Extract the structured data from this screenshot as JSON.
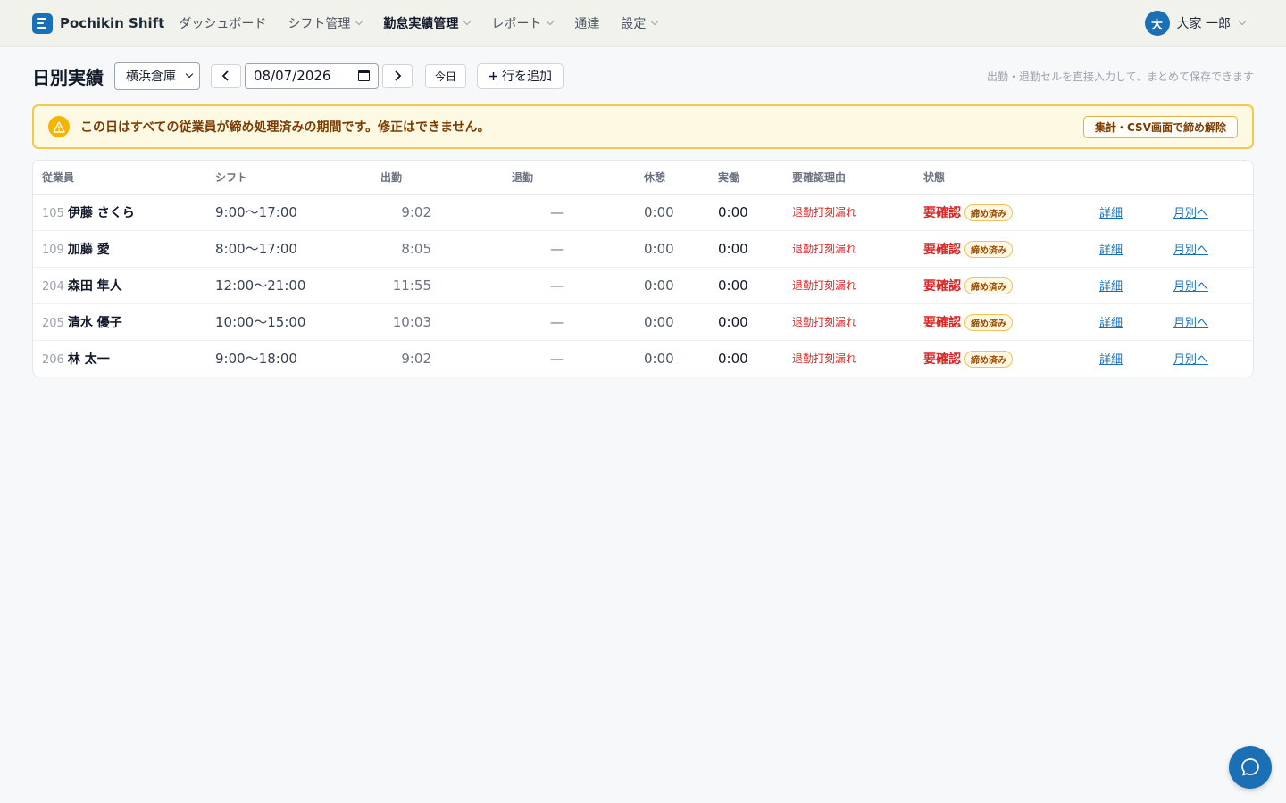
{
  "app": {
    "name": "Pochikin Shift"
  },
  "nav": {
    "items": [
      {
        "label": "ダッシュボード",
        "dropdown": false,
        "active": false
      },
      {
        "label": "シフト管理",
        "dropdown": true,
        "active": false
      },
      {
        "label": "勤怠実績管理",
        "dropdown": true,
        "active": true
      },
      {
        "label": "レポート",
        "dropdown": true,
        "active": false
      },
      {
        "label": "通達",
        "dropdown": false,
        "active": false
      },
      {
        "label": "設定",
        "dropdown": true,
        "active": false
      }
    ]
  },
  "user": {
    "avatar_initial": "大",
    "name": "大家 一郎"
  },
  "toolbar": {
    "title": "日別実績",
    "location": "横浜倉庫",
    "date": "08/07/2026",
    "today_label": "今日",
    "add_row_label": "行を追加",
    "hint": "出勤・退勤セルを直接入力して、まとめて保存できます"
  },
  "alert": {
    "message": "この日はすべての従業員が締め処理済みの期間です。修正はできません。",
    "button_label": "集計・CSV画面で締め解除"
  },
  "table": {
    "headers": [
      "従業員",
      "シフト",
      "出勤",
      "退勤",
      "休憩",
      "実働",
      "要確認理由",
      "状態",
      "",
      ""
    ],
    "rows": [
      {
        "id": "105",
        "name": "伊藤 さくら",
        "shift": "9:00〜17:00",
        "clock_in": "9:02",
        "clock_out": "—",
        "break": "0:00",
        "actual": "0:00",
        "reason": "退勤打刻漏れ",
        "status": "要確認",
        "badge": "締め済み",
        "detail": "詳細",
        "monthly": "月別へ"
      },
      {
        "id": "109",
        "name": "加藤 愛",
        "shift": "8:00〜17:00",
        "clock_in": "8:05",
        "clock_out": "—",
        "break": "0:00",
        "actual": "0:00",
        "reason": "退勤打刻漏れ",
        "status": "要確認",
        "badge": "締め済み",
        "detail": "詳細",
        "monthly": "月別へ"
      },
      {
        "id": "204",
        "name": "森田 隼人",
        "shift": "12:00〜21:00",
        "clock_in": "11:55",
        "clock_out": "—",
        "break": "0:00",
        "actual": "0:00",
        "reason": "退勤打刻漏れ",
        "status": "要確認",
        "badge": "締め済み",
        "detail": "詳細",
        "monthly": "月別へ"
      },
      {
        "id": "205",
        "name": "清水 優子",
        "shift": "10:00〜15:00",
        "clock_in": "10:03",
        "clock_out": "—",
        "break": "0:00",
        "actual": "0:00",
        "reason": "退勤打刻漏れ",
        "status": "要確認",
        "badge": "締め済み",
        "detail": "詳細",
        "monthly": "月別へ"
      },
      {
        "id": "206",
        "name": "林 太一",
        "shift": "9:00〜18:00",
        "clock_in": "9:02",
        "clock_out": "—",
        "break": "0:00",
        "actual": "0:00",
        "reason": "退勤打刻漏れ",
        "status": "要確認",
        "badge": "締め済み",
        "detail": "詳細",
        "monthly": "月別へ"
      }
    ]
  },
  "icons": {
    "brand": "shift-logo-icon",
    "prev": "chevron-left-icon",
    "next": "chevron-right-icon",
    "calendar": "calendar-icon",
    "add": "plus-icon",
    "warning": "warning-icon",
    "chat": "chat-bubble-icon"
  },
  "colors": {
    "primary": "#1a6fb5",
    "warning_bg": "#fef9e3",
    "warning_border": "#f5c84b",
    "error": "#dc2626"
  }
}
